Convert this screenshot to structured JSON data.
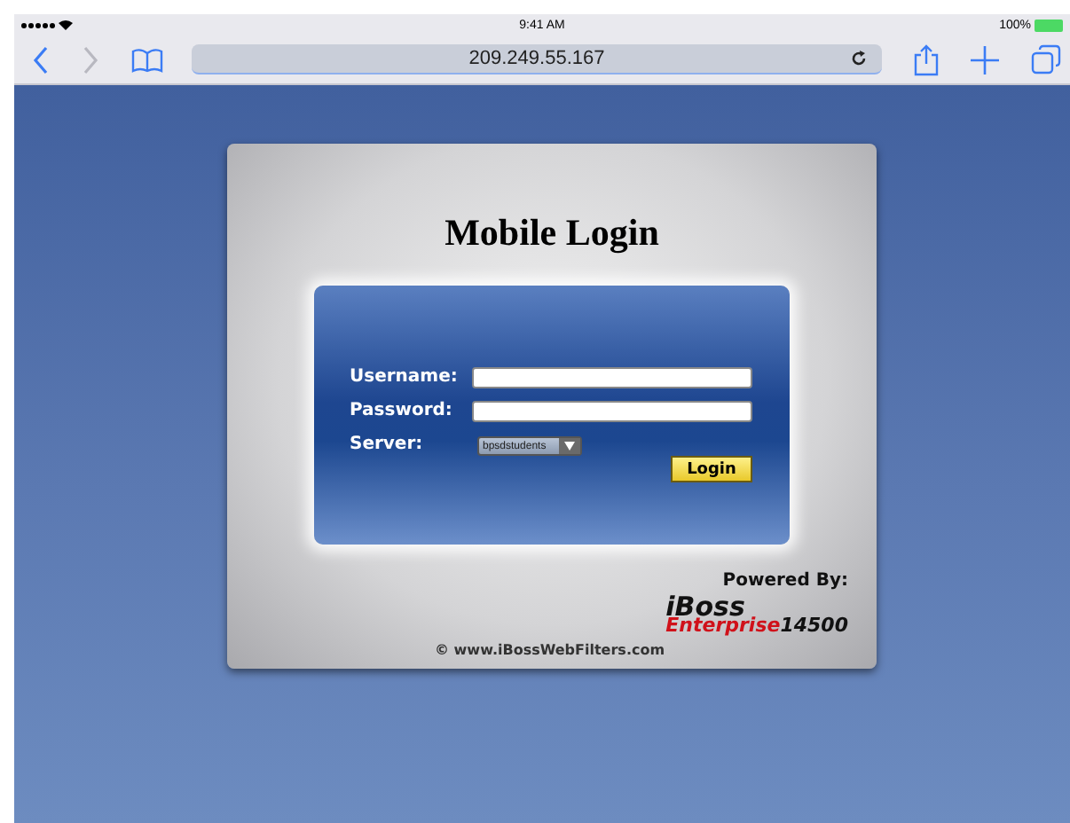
{
  "status_bar": {
    "time": "9:41 AM",
    "battery": "100%"
  },
  "browser": {
    "address": "209.249.55.167",
    "back_disabled": false,
    "forward_disabled": true
  },
  "login": {
    "title": "Mobile Login",
    "fields": [
      {
        "label": "Username:",
        "kind": "text"
      },
      {
        "label": "Password:",
        "kind": "password"
      },
      {
        "label": "Server:",
        "kind": "select",
        "value": "bpsdstudents"
      }
    ],
    "button": "Login",
    "powered_by": "Powered By:",
    "brand": "iBoss",
    "edition": "Enterprise",
    "model": "14500",
    "footer": "© www.iBossWebFilters.com"
  }
}
